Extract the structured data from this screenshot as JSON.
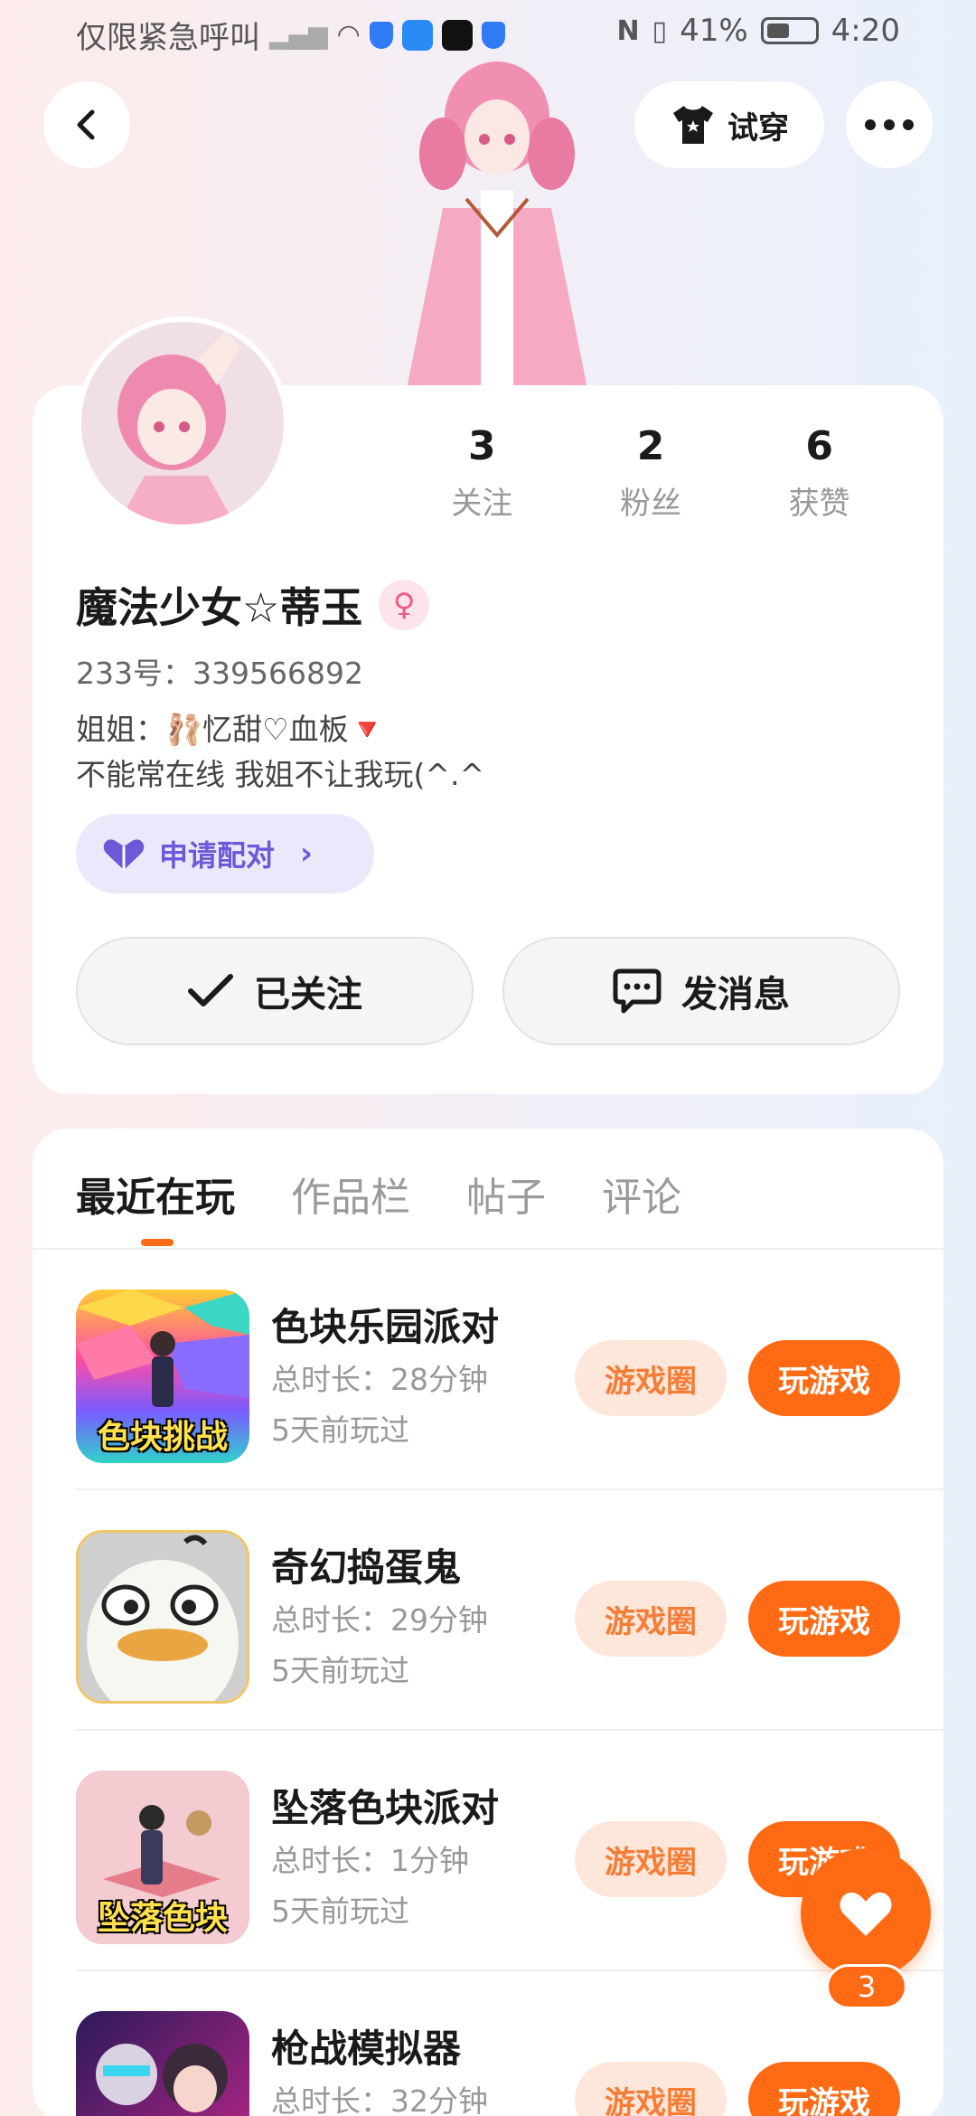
{
  "status_bar": {
    "carrier": "仅限紧急呼叫",
    "battery": "41%",
    "time": "4:20"
  },
  "header": {
    "tryon_label": "试穿"
  },
  "profile": {
    "stats": [
      {
        "value": "3",
        "label": "关注"
      },
      {
        "value": "2",
        "label": "粉丝"
      },
      {
        "value": "6",
        "label": "获赞"
      }
    ],
    "name": "魔法少女☆蒂玉",
    "gender_symbol": "♀",
    "uid": "233号：339566892",
    "bio_line1": "姐姐：🩰忆甜♡血板🔻",
    "bio_line2": "不能常在线 我姐不让我玩(^.^",
    "pair_label": "申请配对",
    "follow_label": "已关注",
    "message_label": "发消息"
  },
  "tabs": [
    {
      "label": "最近在玩",
      "active": true
    },
    {
      "label": "作品栏",
      "active": false
    },
    {
      "label": "帖子",
      "active": false
    },
    {
      "label": "评论",
      "active": false
    }
  ],
  "games": [
    {
      "title": "色块乐园派对",
      "duration": "总时长：28分钟",
      "last_played": "5天前玩过",
      "icon_text": "色块挑战",
      "circle_label": "游戏圈",
      "play_label": "玩游戏"
    },
    {
      "title": "奇幻捣蛋鬼",
      "duration": "总时长：29分钟",
      "last_played": "5天前玩过",
      "icon_text": "",
      "circle_label": "游戏圈",
      "play_label": "玩游戏"
    },
    {
      "title": "坠落色块派对",
      "duration": "总时长：1分钟",
      "last_played": "5天前玩过",
      "icon_text": "坠落色块",
      "circle_label": "游戏圈",
      "play_label": "玩游戏"
    },
    {
      "title": "枪战模拟器",
      "duration": "总时长：32分钟",
      "last_played": "",
      "icon_text": "",
      "circle_label": "游戏圈",
      "play_label": "玩游戏"
    }
  ],
  "fab": {
    "count": "3"
  },
  "colors": {
    "accent": "#ff6a14",
    "accent_light": "#fde6da",
    "pair_purple": "#6d58d8"
  }
}
